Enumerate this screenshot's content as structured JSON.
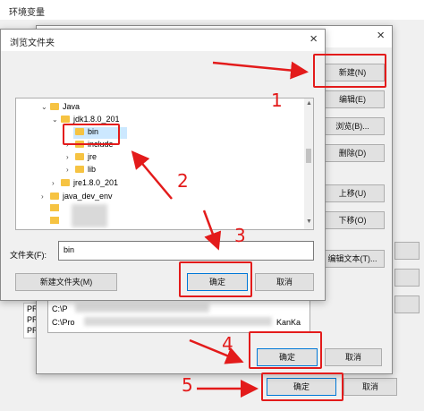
{
  "env_window": {
    "title": "环境变量",
    "confirm": "确定",
    "cancel": "取消"
  },
  "edit_window": {
    "buttons": {
      "new": "新建(N)",
      "edit": "编辑(E)",
      "browse": "浏览(B)...",
      "delete": "删除(D)",
      "move_up": "上移(U)",
      "move_down": "下移(O)",
      "edit_text": "编辑文本(T)..."
    },
    "list_rows": [
      "C:\\P",
      "C:\\Pro",
      "KanKa"
    ],
    "confirm": "确定",
    "cancel": "取消"
  },
  "behind_labels": [
    "PR",
    "PR",
    "PR"
  ],
  "browse_dialog": {
    "title": "浏览文件夹",
    "tree": [
      {
        "label": "Java",
        "arrow": "⌄"
      },
      {
        "label": "jdk1.8.0_201",
        "arrow": "⌄"
      },
      {
        "label": "bin",
        "arrow": ""
      },
      {
        "label": "include",
        "arrow": "›"
      },
      {
        "label": "jre",
        "arrow": "›"
      },
      {
        "label": "lib",
        "arrow": "›"
      },
      {
        "label": "jre1.8.0_201",
        "arrow": "›"
      },
      {
        "label": "java_dev_env",
        "arrow": "›"
      }
    ],
    "folder_label": "文件夹(F):",
    "folder_value": "bin",
    "new_folder": "新建文件夹(M)",
    "confirm": "确定",
    "cancel": "取消"
  },
  "annotations": [
    "1",
    "2",
    "3",
    "4",
    "5"
  ],
  "colors": {
    "annotation": "#e31b1b",
    "folder": "#f6c342",
    "selection": "#cce8ff"
  }
}
